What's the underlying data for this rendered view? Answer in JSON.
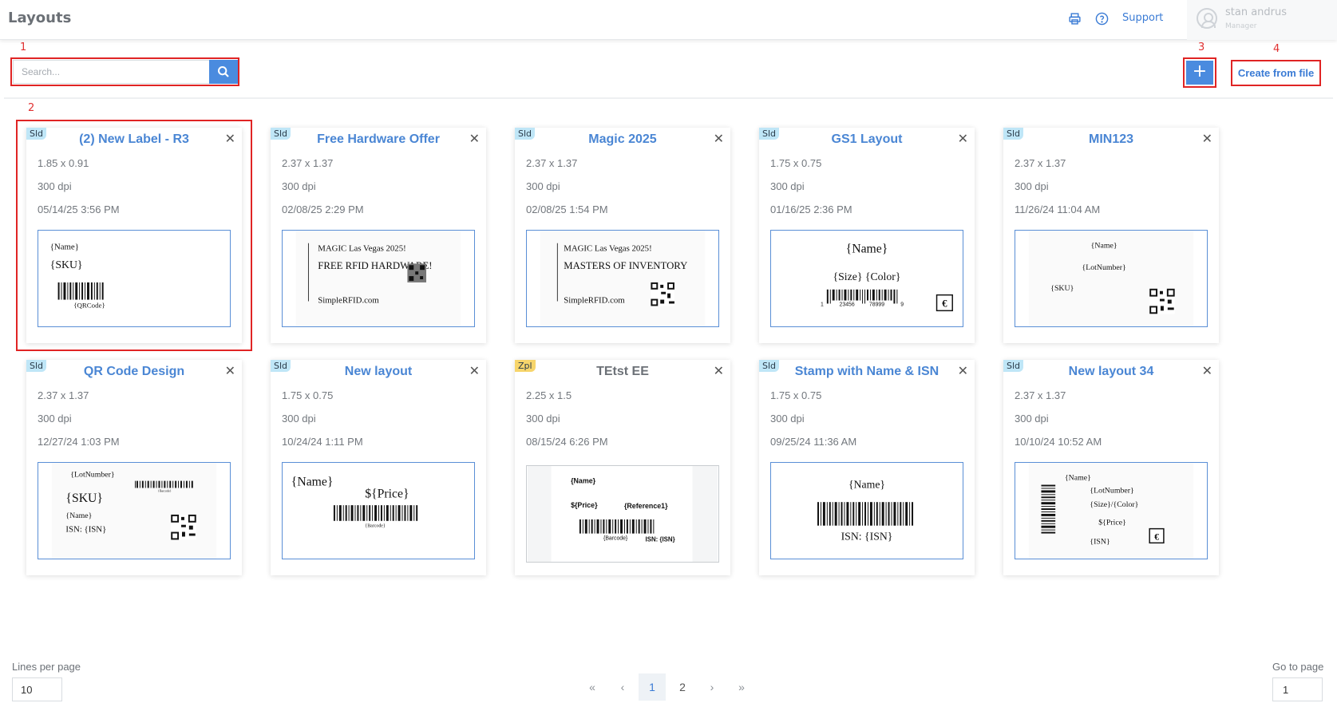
{
  "header": {
    "title": "Layouts",
    "print_icon": "printer-icon",
    "help_icon": "help-circle-icon",
    "support_label": "Support",
    "user_name": "stan andrus",
    "user_role": "Manager"
  },
  "annotations": [
    "1",
    "2",
    "3",
    "4"
  ],
  "toolbar": {
    "search_placeholder": "Search...",
    "search_icon": "search-icon",
    "add_label": "+",
    "create_from_file_label": "Create from file"
  },
  "cards": [
    {
      "tag": "Sld",
      "title": "(2) New Label - R3",
      "size": "1.85 x 0.91",
      "dpi": "300 dpi",
      "date": "05/14/25 3:56 PM"
    },
    {
      "tag": "Sld",
      "title": "Free Hardware Offer",
      "size": "2.37 x 1.37",
      "dpi": "300 dpi",
      "date": "02/08/25 2:29 PM"
    },
    {
      "tag": "Sld",
      "title": "Magic 2025",
      "size": "2.37 x 1.37",
      "dpi": "300 dpi",
      "date": "02/08/25 1:54 PM"
    },
    {
      "tag": "Sld",
      "title": "GS1 Layout",
      "size": "1.75 x 0.75",
      "dpi": "300 dpi",
      "date": "01/16/25 2:36 PM"
    },
    {
      "tag": "Sld",
      "title": "MIN123",
      "size": "2.37 x 1.37",
      "dpi": "300 dpi",
      "date": "11/26/24 11:04 AM"
    },
    {
      "tag": "Sld",
      "title": "QR Code Design",
      "size": "2.37 x 1.37",
      "dpi": "300 dpi",
      "date": "12/27/24 1:03 PM"
    },
    {
      "tag": "Sld",
      "title": "New layout",
      "size": "1.75 x 0.75",
      "dpi": "300 dpi",
      "date": "10/24/24 1:11 PM"
    },
    {
      "tag": "Zpl",
      "title": "TEtst EE",
      "size": "2.25 x 1.5",
      "dpi": "300 dpi",
      "date": "08/15/24 6:26 PM"
    },
    {
      "tag": "Sld",
      "title": "Stamp with Name & ISN",
      "size": "1.75 x 0.75",
      "dpi": "300 dpi",
      "date": "09/25/24 11:36 AM"
    },
    {
      "tag": "Sld",
      "title": "New layout 34",
      "size": "2.37 x 1.37",
      "dpi": "300 dpi",
      "date": "10/10/24 10:52 AM"
    }
  ],
  "previews": {
    "c0": {
      "name": "{Name}",
      "sku": "{SKU}",
      "qr": "{QRCode}"
    },
    "c1": {
      "line1": "MAGIC Las Vegas 2025!",
      "line2": "FREE RFID HARDWARE!",
      "line3": "SimpleRFID.com"
    },
    "c2": {
      "line1": "MAGIC Las Vegas 2025!",
      "line2": "MASTERS OF INVENTORY",
      "line3": "SimpleRFID.com"
    },
    "c3": {
      "name": "{Name}",
      "size_color": "{Size} {Color}",
      "d1": "1",
      "d2": "23456",
      "d3": "78999",
      "d4": "9"
    },
    "c4": {
      "name": "{Name}",
      "lot": "{LotNumber}",
      "sku": "{SKU}"
    },
    "c5": {
      "lot": "{LotNumber}",
      "barcode": "{Barcode}",
      "sku": "{SKU}",
      "name": "{Name}",
      "isn": "ISN: {ISN}"
    },
    "c6": {
      "name": "{Name}",
      "price": "${Price}",
      "barcode": "{Barcode}"
    },
    "c7": {
      "name": "{Name}",
      "price": "${Price}",
      "ref": "{Reference1}",
      "barcode": "{Barcode}",
      "isn": "ISN: {ISN}"
    },
    "c8": {
      "name": "{Name}",
      "isn": "ISN: {ISN}"
    },
    "c9": {
      "name": "{Name}",
      "lot": "{LotNumber}",
      "size_color": "{Size}/{Color}",
      "price": "${Price}",
      "isn": "{ISN}"
    }
  },
  "footer": {
    "lines_per_page_label": "Lines per page",
    "lines_per_page_value": "10",
    "go_to_page_label": "Go to page",
    "go_to_page_value": "1",
    "pages": [
      "1",
      "2"
    ],
    "current_page": "1",
    "first_icon": "«",
    "prev_icon": "‹",
    "next_icon": "›",
    "last_icon": "»"
  }
}
